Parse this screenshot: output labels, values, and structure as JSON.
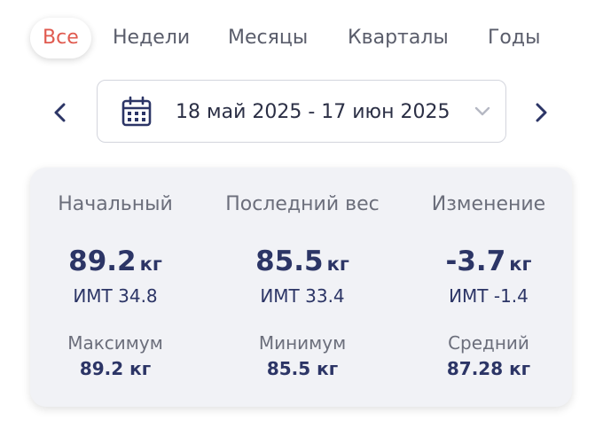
{
  "tabs": [
    {
      "label": "Все",
      "active": true
    },
    {
      "label": "Недели",
      "active": false
    },
    {
      "label": "Месяцы",
      "active": false
    },
    {
      "label": "Кварталы",
      "active": false
    },
    {
      "label": "Годы",
      "active": false
    }
  ],
  "date_range": {
    "label": "18 май 2025 - 17 июн 2025",
    "icon": "calendar-icon",
    "dropdown_icon": "chevron-down-icon"
  },
  "nav": {
    "prev_icon": "chevron-left-icon",
    "next_icon": "chevron-right-icon"
  },
  "stats": {
    "start": {
      "title": "Начальный",
      "value": "89.2",
      "unit": "кг",
      "bmi": "ИМТ 34.8"
    },
    "last": {
      "title": "Последний вес",
      "value": "85.5",
      "unit": "кг",
      "bmi": "ИМТ 33.4"
    },
    "change": {
      "title": "Изменение",
      "value": "-3.7",
      "unit": "кг",
      "bmi": "ИМТ -1.4"
    },
    "max": {
      "title": "Максимум",
      "value": "89.2 кг"
    },
    "min": {
      "title": "Минимум",
      "value": "85.5 кг"
    },
    "avg": {
      "title": "Средний",
      "value": "87.28 кг"
    }
  },
  "colors": {
    "accent": "#e05a4f",
    "primary_text": "#2c3566",
    "muted_text": "#6b6e7b",
    "card_bg": "#f1f2f6"
  }
}
